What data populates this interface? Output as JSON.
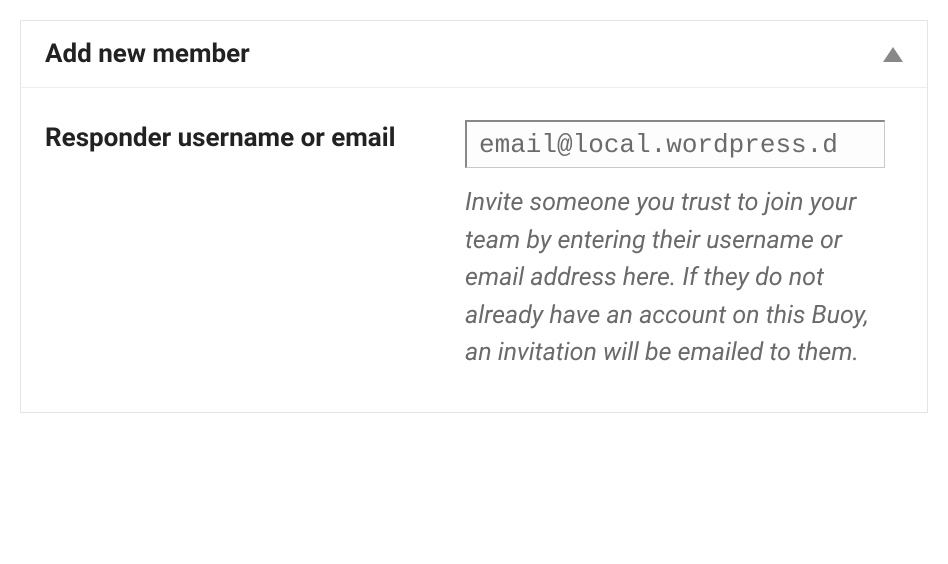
{
  "panel": {
    "title": "Add new member"
  },
  "form": {
    "field_label": "Responder username or email",
    "input_value": "email@local.wordpress.d",
    "help_text": "Invite someone you trust to join your team by entering their username or email address here. If they do not already have an account on this Buoy, an invitation will be emailed to them."
  }
}
